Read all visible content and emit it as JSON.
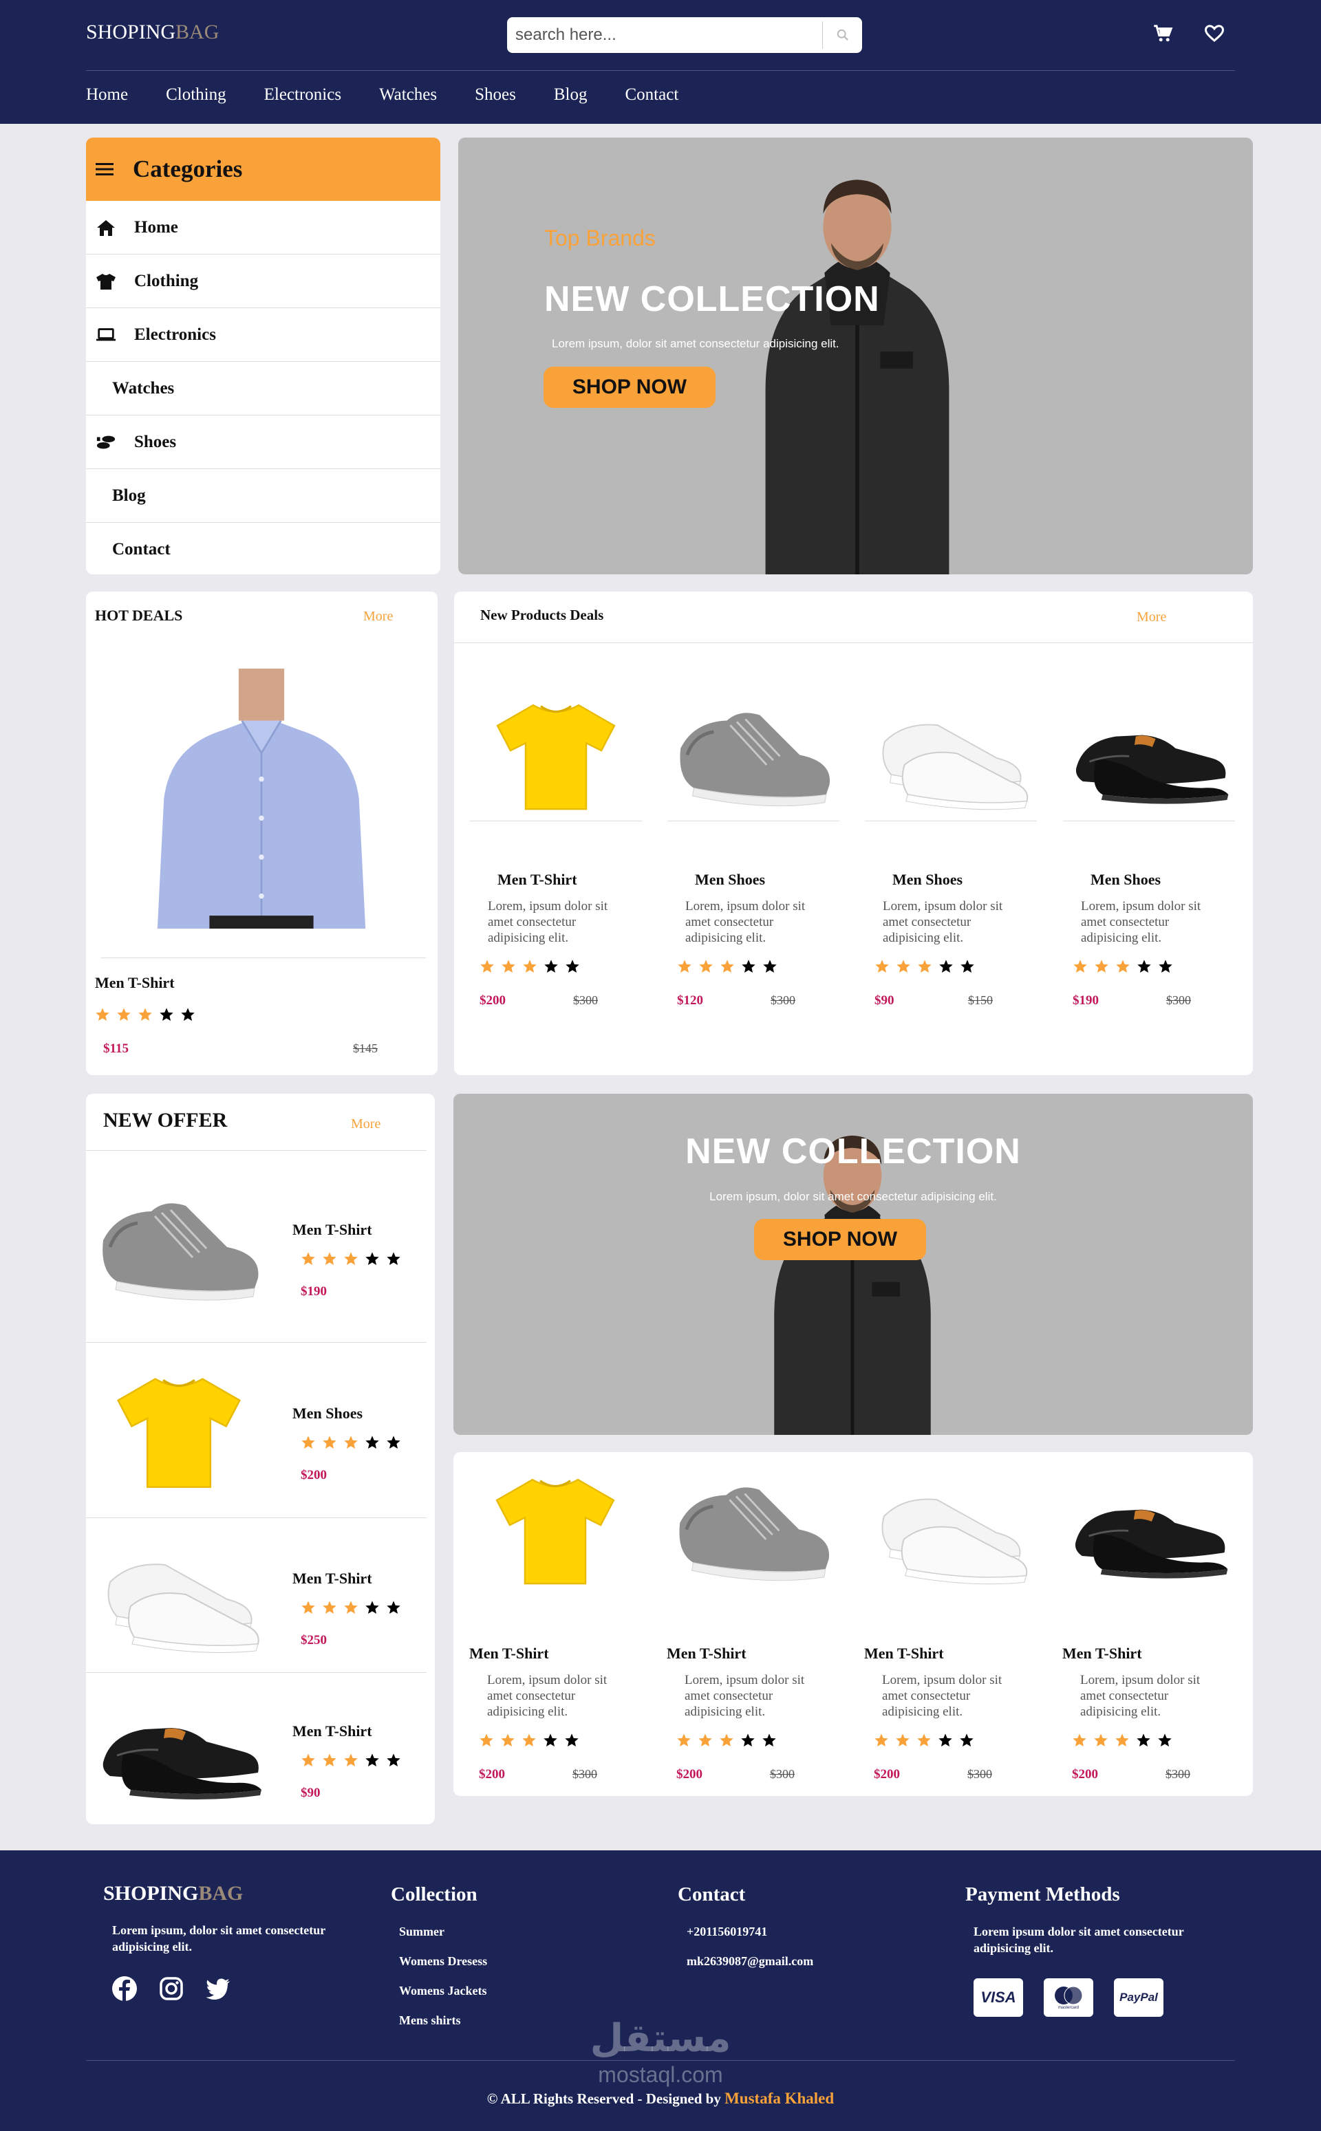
{
  "header": {
    "logo_a": "SHOPING",
    "logo_b": "BAG",
    "search_placeholder": "search here...",
    "nav": [
      "Home",
      "Clothing",
      "Electronics",
      "Watches",
      "Shoes",
      "Blog",
      "Contact"
    ]
  },
  "colors": {
    "navy": "#1b2454",
    "accent": "#f9a23a",
    "price": "#c3175a",
    "logo_bag": "#9c8a78"
  },
  "categories": {
    "title": "Categories",
    "items": [
      {
        "label": "Home",
        "icon": "home-icon"
      },
      {
        "label": "Clothing",
        "icon": "tshirt-icon"
      },
      {
        "label": "Electronics",
        "icon": "laptop-icon"
      },
      {
        "label": "Watches",
        "icon": ""
      },
      {
        "label": "Shoes",
        "icon": "shoe-prints-icon"
      },
      {
        "label": "Blog",
        "icon": ""
      },
      {
        "label": "Contact",
        "icon": ""
      }
    ]
  },
  "hero": {
    "subtitle": "Top Brands",
    "title": "NEW COLLECTION",
    "text": "Lorem ipsum, dolor sit amet consectetur adipisicing elit.",
    "button": "SHOP NOW"
  },
  "hot_deals": {
    "title": "HOT DEALS",
    "more": "More",
    "product": {
      "name": "Men T-Shirt",
      "price": "$115",
      "old_price": "$145",
      "rating": 3
    }
  },
  "new_products": {
    "title": "New Products Deals",
    "more": "More",
    "items": [
      {
        "name": "Men T-Shirt",
        "desc": "Lorem, ipsum dolor sit amet consectetur adipisicing elit.",
        "price": "$200",
        "old_price": "$300",
        "rating": 3,
        "image": "yellow-tshirt"
      },
      {
        "name": "Men Shoes",
        "desc": "Lorem, ipsum dolor sit amet consectetur adipisicing elit.",
        "price": "$120",
        "old_price": "$300",
        "rating": 3,
        "image": "grey-sneaker"
      },
      {
        "name": "Men Shoes",
        "desc": "Lorem, ipsum dolor sit amet consectetur adipisicing elit.",
        "price": "$90",
        "old_price": "$150",
        "rating": 3,
        "image": "white-sneakers"
      },
      {
        "name": "Men Shoes",
        "desc": "Lorem, ipsum dolor sit amet consectetur adipisicing elit.",
        "price": "$190",
        "old_price": "$300",
        "rating": 3,
        "image": "black-oxfords"
      }
    ]
  },
  "new_offer": {
    "title": "NEW OFFER",
    "more": "More",
    "items": [
      {
        "name": "Men T-Shirt",
        "price": "$190",
        "rating": 3,
        "image": "grey-sneaker"
      },
      {
        "name": "Men Shoes",
        "price": "$200",
        "rating": 3,
        "image": "yellow-tshirt"
      },
      {
        "name": "Men T-Shirt",
        "price": "$250",
        "rating": 3,
        "image": "white-sneakers"
      },
      {
        "name": "Men T-Shirt",
        "price": "$90",
        "rating": 3,
        "image": "black-oxfords"
      }
    ]
  },
  "banner2": {
    "title": "NEW COLLECTION",
    "text": "Lorem ipsum, dolor sit amet consectetur adipisicing elit.",
    "button": "SHOP NOW"
  },
  "bottom_products": {
    "items": [
      {
        "name": "Men T-Shirt",
        "desc": "Lorem, ipsum dolor sit amet consectetur adipisicing elit.",
        "price": "$200",
        "old_price": "$300",
        "rating": 3,
        "image": "yellow-tshirt"
      },
      {
        "name": "Men T-Shirt",
        "desc": "Lorem, ipsum dolor sit amet consectetur adipisicing elit.",
        "price": "$200",
        "old_price": "$300",
        "rating": 3,
        "image": "grey-sneaker"
      },
      {
        "name": "Men T-Shirt",
        "desc": "Lorem, ipsum dolor sit amet consectetur adipisicing elit.",
        "price": "$200",
        "old_price": "$300",
        "rating": 3,
        "image": "white-sneakers"
      },
      {
        "name": "Men T-Shirt",
        "desc": "Lorem, ipsum dolor sit amet consectetur adipisicing elit.",
        "price": "$200",
        "old_price": "$300",
        "rating": 3,
        "image": "black-oxfords"
      }
    ]
  },
  "footer": {
    "about": "Lorem ipsum, dolor sit amet consectetur adipisicing elit.",
    "collection_title": "Collection",
    "collection": [
      "Summer",
      "Womens Dresess",
      "Womens Jackets",
      "Mens shirts"
    ],
    "contact_title": "Contact",
    "phone": "+201156019741",
    "email": "mk2639087@gmail.com",
    "payment_title": "Payment Methods",
    "payment_text": "Lorem ipsum dolor sit amet consectetur adipisicing elit.",
    "payment_methods": [
      "VISA",
      "mastercard",
      "PayPal"
    ],
    "copyright": "© ALL Rights Reserved - Designed by",
    "designer": "Mustafa Khaled",
    "watermark_ar": "مستقل",
    "watermark": "mostaql.com"
  }
}
